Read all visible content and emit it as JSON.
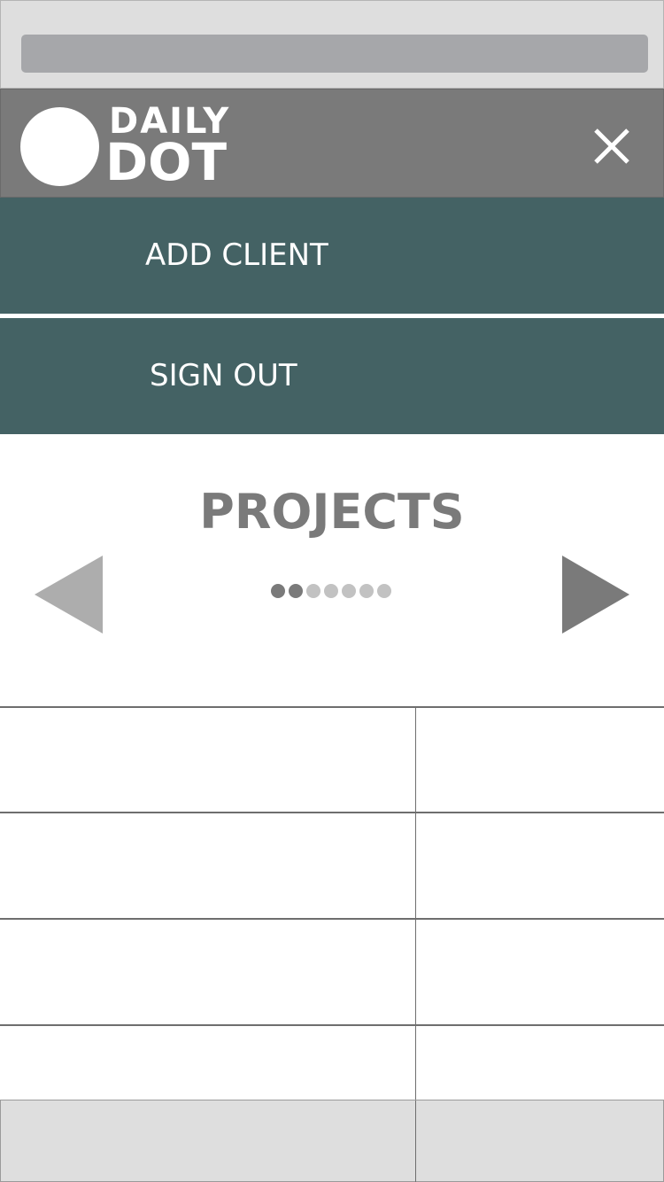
{
  "logo": {
    "line1": "DAILY",
    "line2": "DOT"
  },
  "header": {
    "close_icon": "close-icon"
  },
  "menu": {
    "items": [
      {
        "label": "ADD CLIENT"
      },
      {
        "label": "SIGN OUT"
      }
    ]
  },
  "projects": {
    "title": "PROJECTS",
    "pager": {
      "total": 7,
      "active": [
        0,
        1
      ]
    },
    "prev_icon": "triangle-left-icon",
    "next_icon": "triangle-right-icon"
  },
  "colors": {
    "status_bar": "#dedede",
    "address_bar": "#a6a7aa",
    "header_bg": "#7a7a7a",
    "menu_bg": "#446264",
    "title": "#7a7a7a",
    "dot_active": "#7a7a7a",
    "dot_inactive": "#c2c2c2",
    "arrow_prev": "#adadad",
    "arrow_next": "#7a7a7a"
  }
}
